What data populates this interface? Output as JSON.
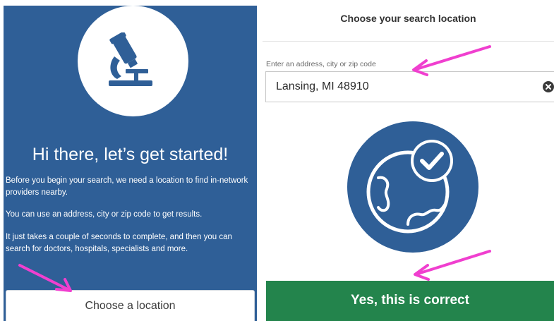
{
  "welcome": {
    "title": "Hi there, let’s get started!",
    "paragraphs": [
      "Before you begin your search, we need a location to find in-network providers nearby.",
      "You can use an address, city or zip code to get results.",
      "It just takes a couple of seconds to complete, and then you can search for doctors, hospitals, specialists and more."
    ],
    "choose_location_label": "Choose a location",
    "hero_icon": "microscope-icon"
  },
  "location_modal": {
    "title": "Choose your search location",
    "input_label": "Enter an address, city or zip code",
    "input_value": "Lansing, MI 48910",
    "clear_icon": "clear-icon",
    "illustration_icon": "globe-check-icon",
    "confirm_label": "Yes, this is correct"
  },
  "colors": {
    "panel_blue": "#2f5f97",
    "confirm_green": "#23844c",
    "annotation_arrow": "#f03fcf"
  }
}
